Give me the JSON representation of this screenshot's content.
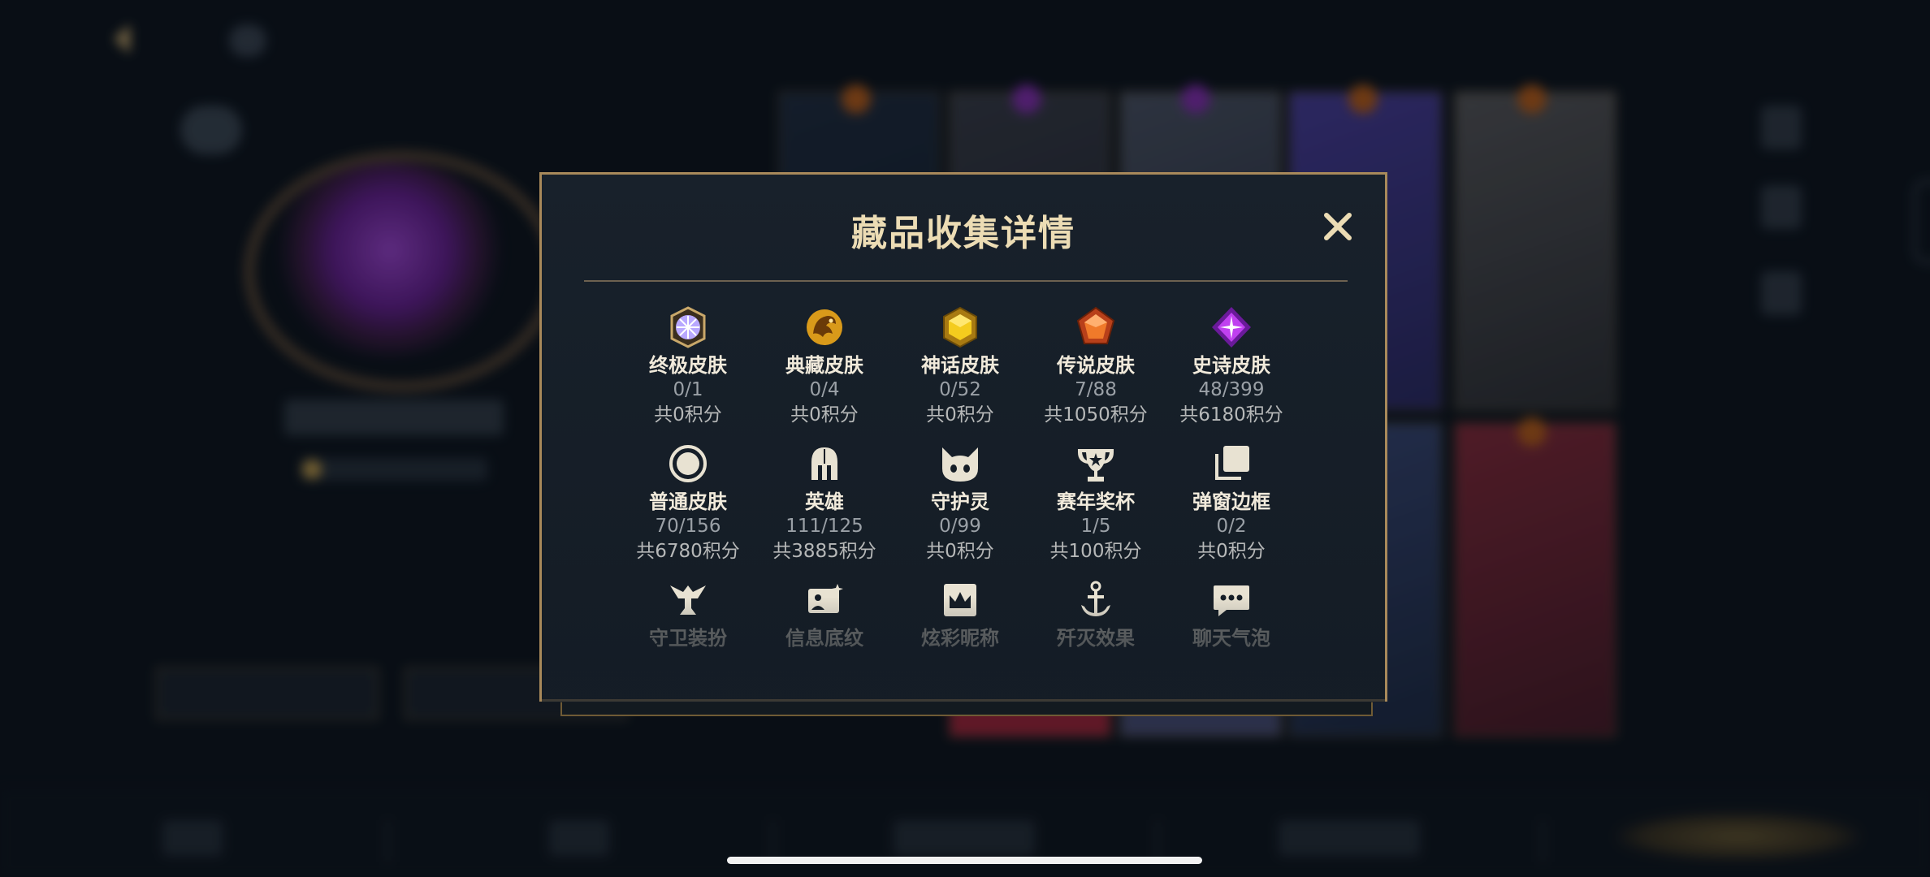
{
  "modal": {
    "title": "藏品收集详情",
    "close_label": "✕",
    "rows": [
      [
        {
          "icon": "ultimate-skin-icon",
          "name": "终极皮肤",
          "count": "0/1",
          "points": "共0积分"
        },
        {
          "icon": "collector-skin-icon",
          "name": "典藏皮肤",
          "count": "0/4",
          "points": "共0积分"
        },
        {
          "icon": "mythic-skin-icon",
          "name": "神话皮肤",
          "count": "0/52",
          "points": "共0积分"
        },
        {
          "icon": "legendary-skin-icon",
          "name": "传说皮肤",
          "count": "7/88",
          "points": "共1050积分"
        },
        {
          "icon": "epic-skin-icon",
          "name": "史诗皮肤",
          "count": "48/399",
          "points": "共6180积分"
        }
      ],
      [
        {
          "icon": "normal-skin-icon",
          "name": "普通皮肤",
          "count": "70/156",
          "points": "共6780积分"
        },
        {
          "icon": "champion-helmet-icon",
          "name": "英雄",
          "count": "111/125",
          "points": "共3885积分"
        },
        {
          "icon": "little-legend-icon",
          "name": "守护灵",
          "count": "0/99",
          "points": "共0积分"
        },
        {
          "icon": "trophy-icon",
          "name": "赛年奖杯",
          "count": "1/5",
          "points": "共100积分"
        },
        {
          "icon": "popup-frame-icon",
          "name": "弹窗边框",
          "count": "0/2",
          "points": "共0积分"
        }
      ],
      [
        {
          "icon": "ward-skin-icon",
          "name": "守卫装扮"
        },
        {
          "icon": "profile-background-icon",
          "name": "信息底纹"
        },
        {
          "icon": "nickname-crown-icon",
          "name": "炫彩昵称"
        },
        {
          "icon": "elimination-effect-icon",
          "name": "歼灭效果"
        },
        {
          "icon": "chat-bubble-icon",
          "name": "聊天气泡"
        }
      ]
    ]
  },
  "colors": {
    "gold_border": "#a8895a",
    "title": "#ecdcb4",
    "modal_bg": "#18212b"
  }
}
